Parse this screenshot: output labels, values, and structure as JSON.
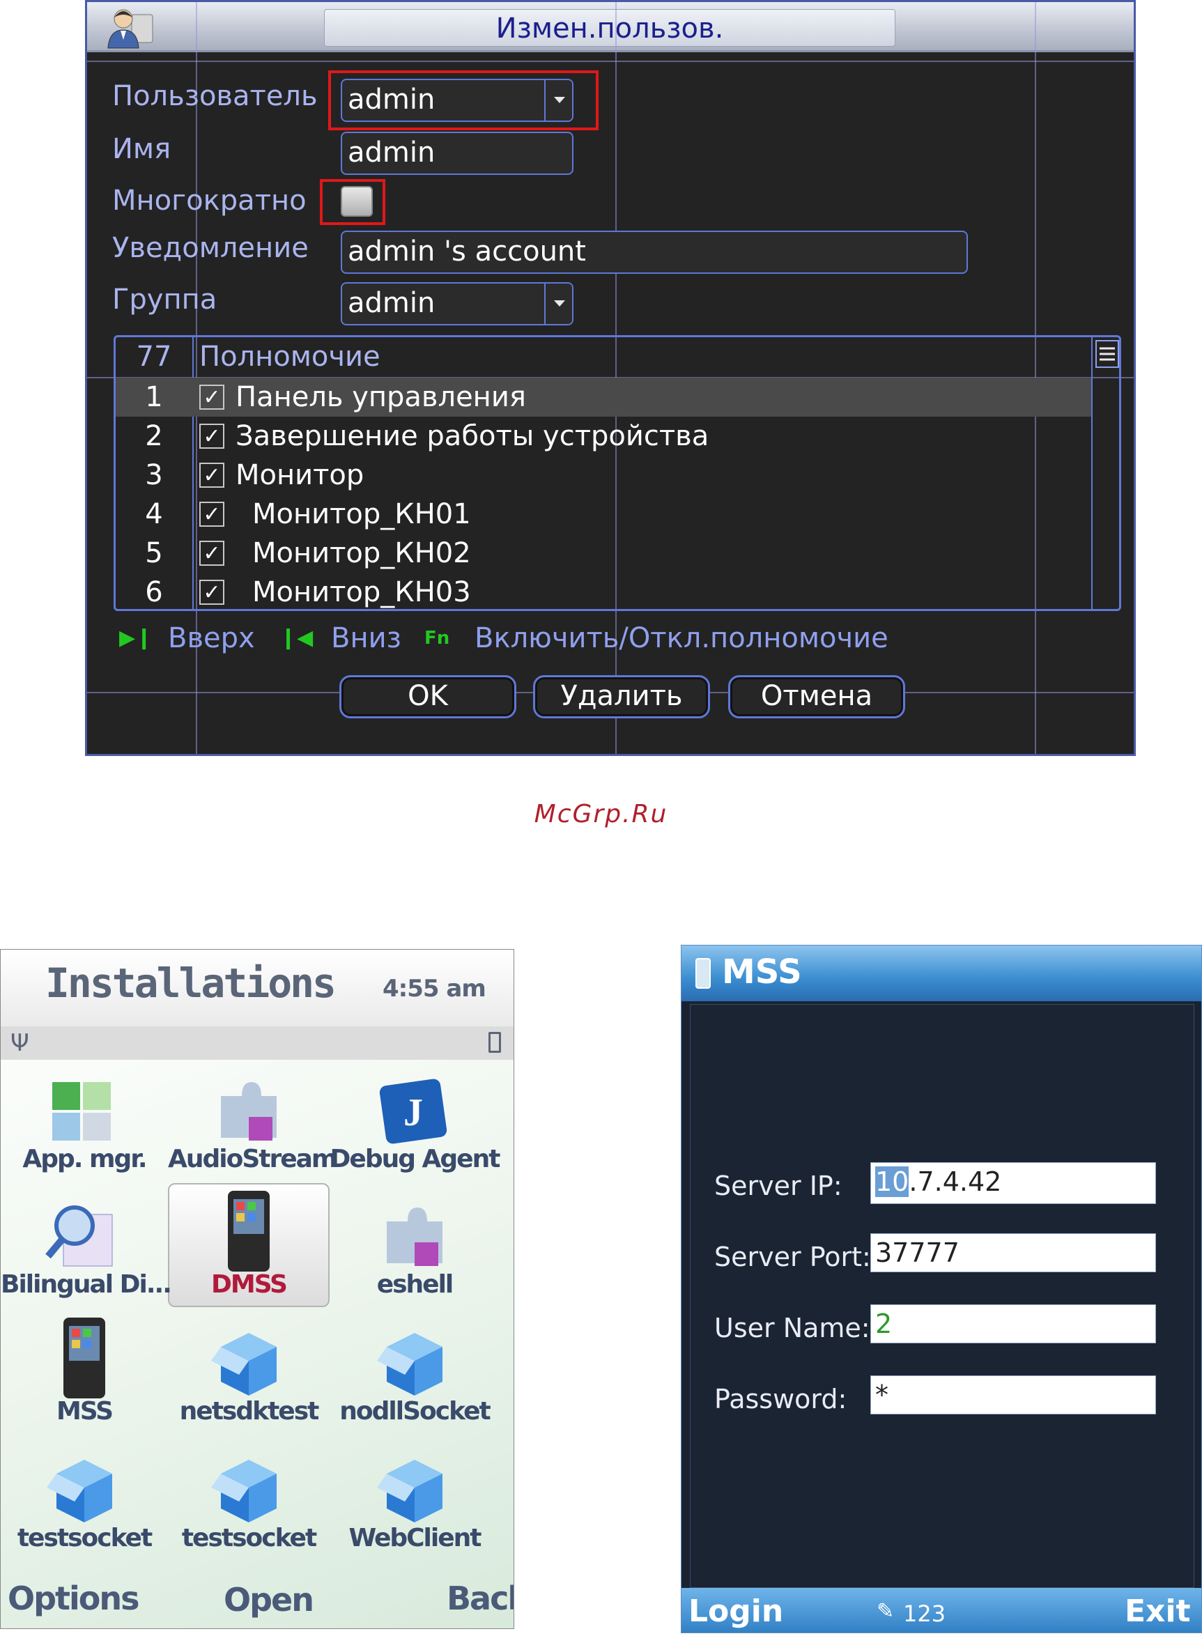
{
  "dvr": {
    "title": "Измен.пользов.",
    "labels": {
      "user": "Пользователь",
      "name": "Имя",
      "multiple": "Многократно",
      "notice": "Уведомление",
      "group": "Группа"
    },
    "values": {
      "user": "admin",
      "name": "admin",
      "multiple_checked": false,
      "notice": "admin 's account",
      "group": "admin"
    },
    "table": {
      "count": "77",
      "header": "Полномочие",
      "rows": [
        {
          "num": "1",
          "checked": true,
          "label": "Панель управления"
        },
        {
          "num": "2",
          "checked": true,
          "label": "Завершение работы устройства"
        },
        {
          "num": "3",
          "checked": true,
          "label": "Монитор"
        },
        {
          "num": "4",
          "checked": true,
          "label": "Монитор_КН01"
        },
        {
          "num": "5",
          "checked": true,
          "label": "Монитор_КН02"
        },
        {
          "num": "6",
          "checked": true,
          "label": "Монитор_КН03"
        }
      ]
    },
    "hints": {
      "up": "Вверх",
      "down": "Вниз",
      "fn_icon": "Fn",
      "toggle": "Включить/Откл.полномочие"
    },
    "buttons": {
      "ok": "OK",
      "delete": "Удалить",
      "cancel": "Отмена"
    },
    "colors": {
      "highlight": "#e01818",
      "label": "#aab4ee",
      "border": "#5f78d8"
    }
  },
  "watermark": "McGrp.Ru",
  "phone1": {
    "title": "Installations",
    "time": "4:55 am",
    "apps": [
      {
        "label": "App. mgr.",
        "icon": "cubes-icon"
      },
      {
        "label": "AudioStream",
        "icon": "puzzle-icon"
      },
      {
        "label": "Debug Agent",
        "icon": "java-icon"
      },
      {
        "label": "Bilingual Di...",
        "icon": "dictionary-icon"
      },
      {
        "label": "DMSS",
        "icon": "phone-app-icon"
      },
      {
        "label": "eshell",
        "icon": "puzzle-icon"
      },
      {
        "label": "MSS",
        "icon": "phone-app-icon"
      },
      {
        "label": "netsdktest",
        "icon": "box-icon"
      },
      {
        "label": "nodllSocket",
        "icon": "box-icon"
      },
      {
        "label": "testsocket",
        "icon": "box-icon"
      },
      {
        "label": "testsocket",
        "icon": "box-icon"
      },
      {
        "label": "WebClient",
        "icon": "box-icon"
      }
    ],
    "softkeys": {
      "left": "Options",
      "center": "Open",
      "right": "Back"
    }
  },
  "phone2": {
    "title": "MSS",
    "fields": [
      {
        "label": "Server IP:",
        "value_highlight": "10",
        "value": ".7.4.42"
      },
      {
        "label": "Server Port:",
        "value": "37777"
      },
      {
        "label": "User Name:",
        "value": "2"
      },
      {
        "label": "Password:",
        "value": "*"
      }
    ],
    "softkeys": {
      "left": "Login",
      "center": "123",
      "right": "Exit"
    }
  }
}
